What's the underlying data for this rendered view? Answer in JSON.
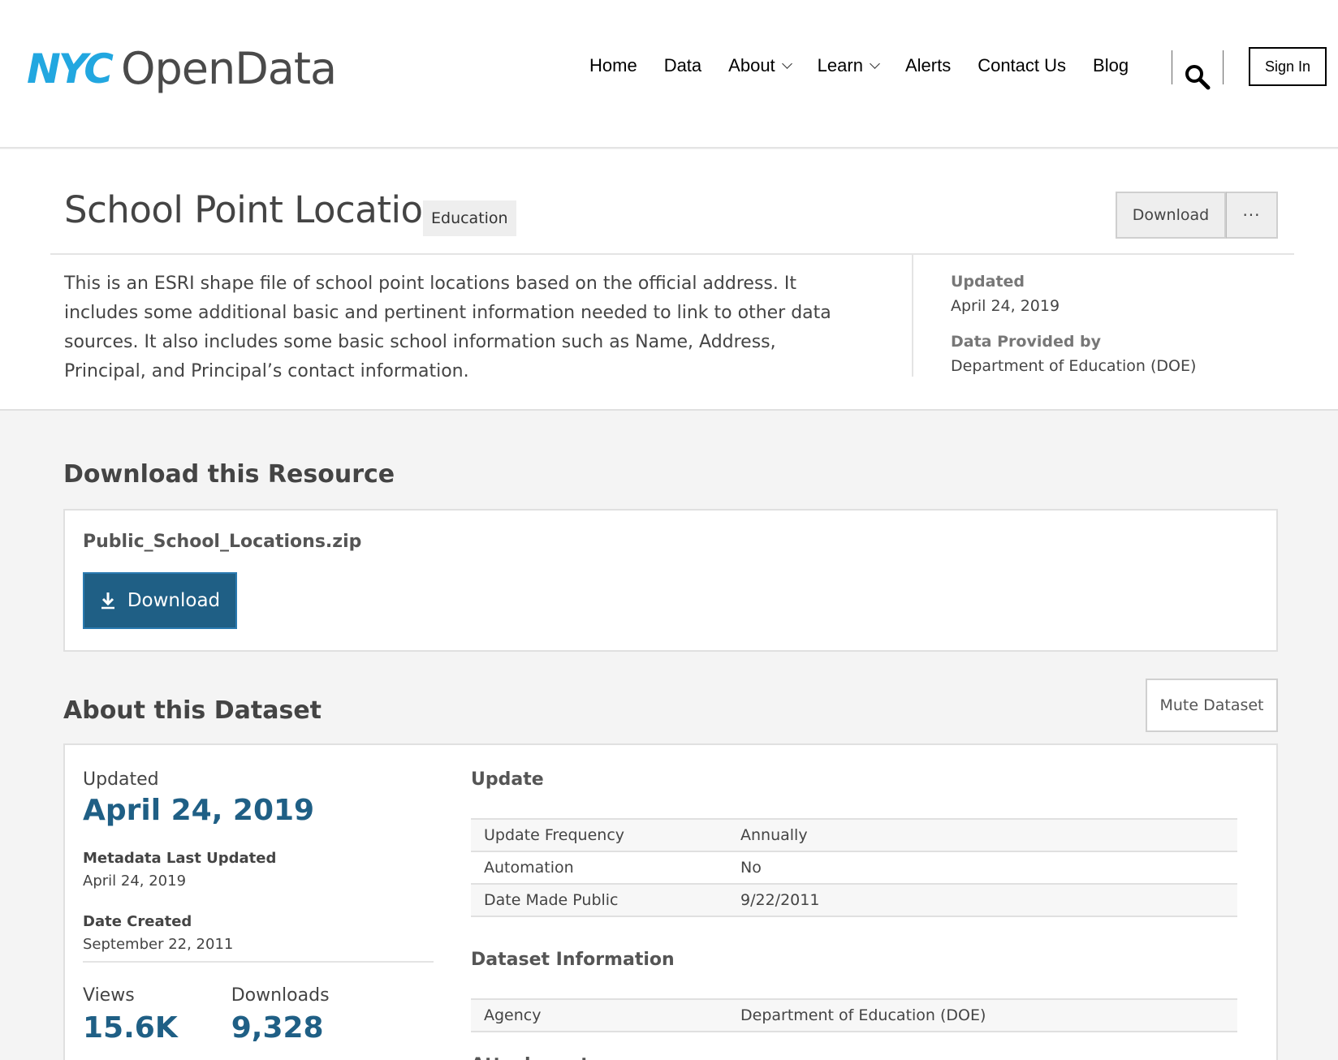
{
  "header": {
    "logo_nyc": "NYC",
    "logo_open": "OpenData",
    "nav": [
      {
        "label": "Home",
        "has_dropdown": false
      },
      {
        "label": "Data",
        "has_dropdown": false
      },
      {
        "label": "About",
        "has_dropdown": true
      },
      {
        "label": "Learn",
        "has_dropdown": true
      },
      {
        "label": "Alerts",
        "has_dropdown": false
      },
      {
        "label": "Contact Us",
        "has_dropdown": false
      },
      {
        "label": "Blog",
        "has_dropdown": false
      }
    ],
    "search_icon": "search-icon",
    "sign_in": "Sign In"
  },
  "dataset": {
    "title": "School Point Locations",
    "category": "Education",
    "download_label": "Download",
    "more_label": "···",
    "description": "This is an ESRI shape file of school point locations based on the official address.  It includes some additional basic and pertinent information needed to link to other data sources. It also includes some basic school information such as Name, Address, Principal, and Principal’s contact information.",
    "side": {
      "updated_label": "Updated",
      "updated_value": "April 24, 2019",
      "provider_label": "Data Provided by",
      "provider_value": "Department of Education (DOE)"
    }
  },
  "download_section": {
    "title": "Download this Resource",
    "filename": "Public_School_Locations.zip",
    "button": "Download",
    "icon": "download-icon"
  },
  "about": {
    "title": "About this Dataset",
    "mute": "Mute Dataset",
    "updated_label": "Updated",
    "updated_value": "April 24, 2019",
    "metadata_label": "Metadata Last Updated",
    "metadata_value": "April 24, 2019",
    "created_label": "Date Created",
    "created_value": "September 22, 2011",
    "views_label": "Views",
    "views_value": "15.6K",
    "downloads_label": "Downloads",
    "downloads_value": "9,328",
    "update_group": {
      "title": "Update",
      "rows": [
        {
          "key": "Update Frequency",
          "value": "Annually"
        },
        {
          "key": "Automation",
          "value": "No"
        },
        {
          "key": "Date Made Public",
          "value": "9/22/2011"
        }
      ]
    },
    "info_group": {
      "title": "Dataset Information",
      "rows": [
        {
          "key": "Agency",
          "value": "Department of Education (DOE)"
        }
      ]
    },
    "attachments_title": "Attachments"
  },
  "colors": {
    "brand_blue": "#22a7e0",
    "primary": "#1f5f85"
  }
}
